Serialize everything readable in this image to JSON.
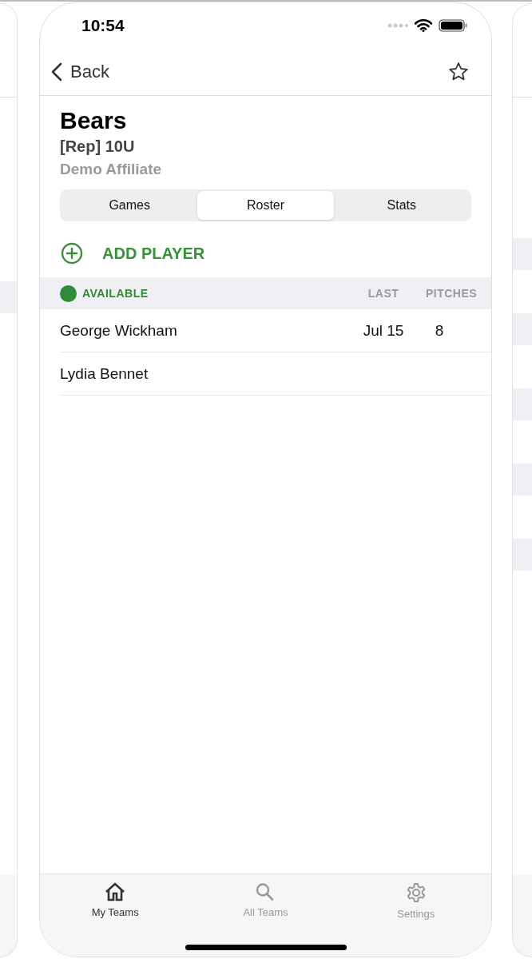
{
  "status_bar": {
    "time": "10:54"
  },
  "nav": {
    "back": "Back",
    "favorite": false
  },
  "team": {
    "name": "Bears",
    "level": "[Rep] 10U",
    "affiliate": "Demo Affiliate"
  },
  "tabs": [
    {
      "label": "Games",
      "selected": false
    },
    {
      "label": "Roster",
      "selected": true
    },
    {
      "label": "Stats",
      "selected": false
    }
  ],
  "add_action": "ADD PLAYER",
  "section": {
    "title": "AVAILABLE",
    "color": "#2e8b37",
    "columns": [
      "LAST",
      "PITCHES"
    ]
  },
  "players": [
    {
      "name": "George Wickham",
      "last": "Jul 15",
      "pitches": "8"
    },
    {
      "name": "Lydia Bennet"
    }
  ],
  "tab_bar": [
    {
      "label": "My Teams",
      "kind": "home",
      "selected": true
    },
    {
      "label": "All Teams",
      "kind": "search",
      "selected": false
    },
    {
      "label": "Settings",
      "kind": "settings",
      "selected": false
    }
  ]
}
